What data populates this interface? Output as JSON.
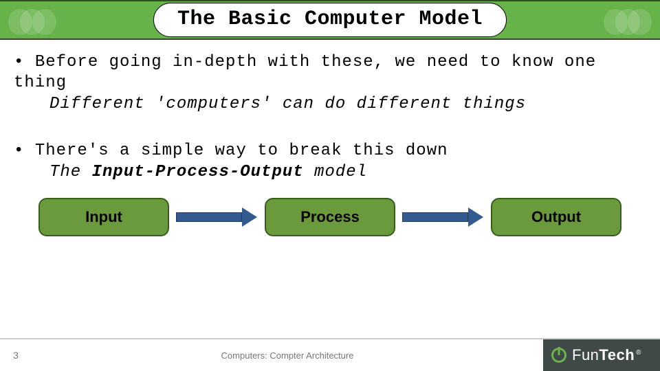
{
  "title": "The Basic Computer Model",
  "bullets": {
    "b1": "Before going in-depth with these, we need to know one thing",
    "b1_sub": "Different 'computers' can do different things",
    "b2": "There's a simple way to break this down",
    "b2_sub_prefix": "The ",
    "b2_sub_bold": "Input-Process-Output",
    "b2_sub_suffix": " model"
  },
  "flow": {
    "box1": "Input",
    "box2": "Process",
    "box3": "Output"
  },
  "footer": {
    "page": "3",
    "subject": "Computers: Compter Architecture",
    "brand_fun": "Fun",
    "brand_tech": "Tech",
    "brand_reg": "®"
  },
  "colors": {
    "ribbon": "#67b34a",
    "box_fill": "#6a9a3b",
    "arrow": "#335b8f",
    "brand_bg": "#3f4a48",
    "brand_accent": "#6db24c"
  }
}
